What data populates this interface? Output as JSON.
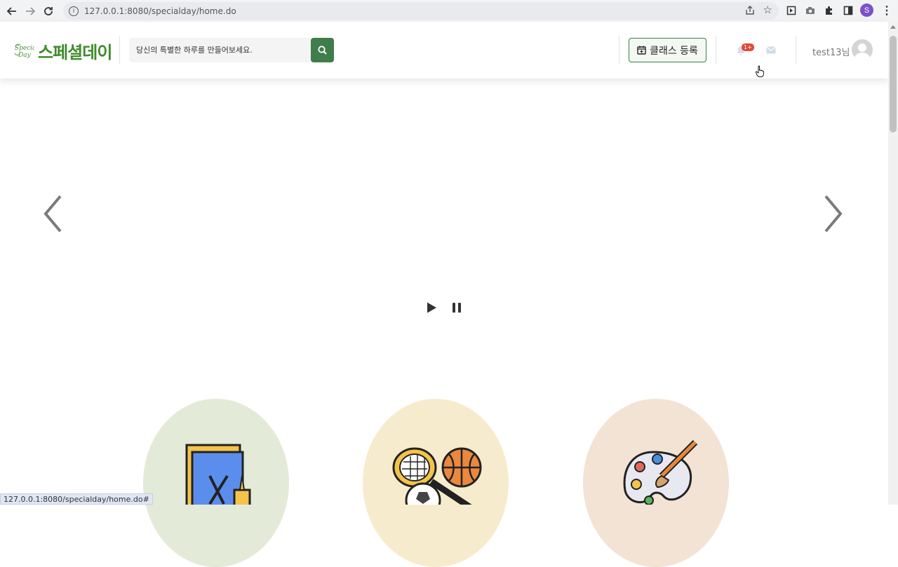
{
  "browser": {
    "url": "127.0.0.1:8080/specialday/home.do",
    "profile_initial": "S"
  },
  "header": {
    "logo_text": "스페셜데이",
    "logo_mark": "Special Day",
    "search_placeholder": "당신의 특별한 하루를 만들어보세요.",
    "class_register_label": "클래스 등록",
    "notification_badge": "1+",
    "user_name": "test13님"
  },
  "categories": [
    {
      "icon": "craft-icon",
      "color": "#e4ead8"
    },
    {
      "icon": "sports-icon",
      "color": "#f6eccd"
    },
    {
      "icon": "art-palette-icon",
      "color": "#f3e3d5"
    }
  ],
  "status_bar": {
    "url": "127.0.0.1:8080/specialday/home.do#"
  }
}
